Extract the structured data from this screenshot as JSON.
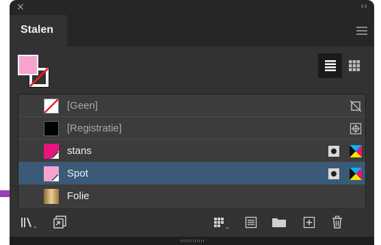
{
  "panel": {
    "tab_label": "Stalen",
    "close_icon": "close-icon",
    "collapse_icon": "collapse-icon",
    "collapse_glyph": "‹‹",
    "close_glyph": "✕",
    "menu_icon": "panel-menu-icon"
  },
  "fill_stroke": {
    "fill_color": "#f5a3cf",
    "stroke": "none"
  },
  "view": {
    "active": "list"
  },
  "swatches": [
    {
      "name": "[Geen]",
      "color": "none",
      "dim": true,
      "icons": [
        "not-editable-icon"
      ]
    },
    {
      "name": "[Registratie]",
      "color": "#000000",
      "dim": true,
      "icons": [
        "registration-icon"
      ]
    },
    {
      "name": "stans",
      "color": "#e8137e",
      "dim": false,
      "icons": [
        "spot-color-icon",
        "cmyk-icon"
      ]
    },
    {
      "name": "Spot",
      "color": "#f5a3cf",
      "dim": false,
      "selected": true,
      "icons": [
        "spot-color-icon",
        "cmyk-icon"
      ]
    },
    {
      "name": "Folie",
      "color": "#c9a46a",
      "dim": false,
      "icons": []
    }
  ],
  "colors": {
    "panel_bg": "#323232",
    "selected_row": "#3a5a78",
    "arrow": "#9b3fb5"
  }
}
